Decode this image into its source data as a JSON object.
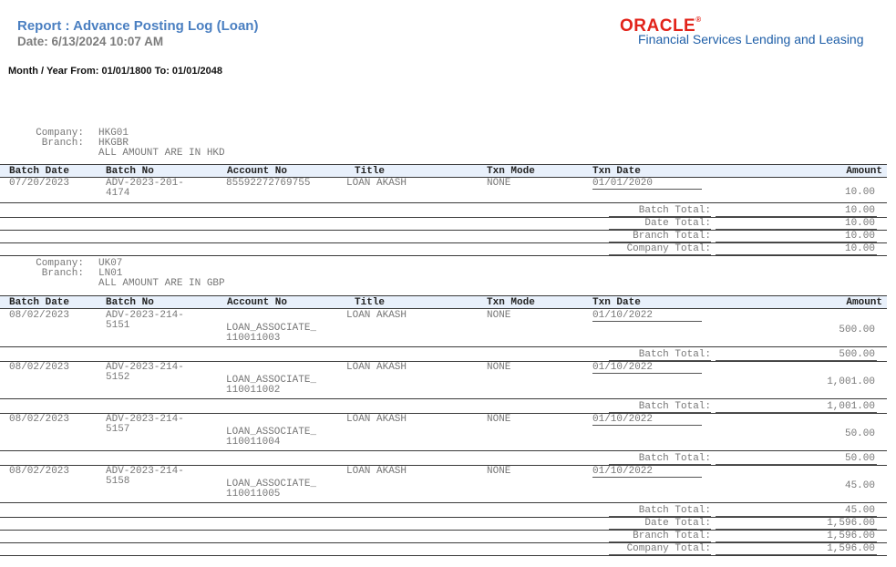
{
  "header": {
    "title": "Report : Advance Posting Log (Loan)",
    "date": "Date: 6/13/2024  10:07 AM",
    "logo_text": "ORACLE",
    "logo_tm": "®",
    "logo_subtitle": "Financial Services Lending and Leasing",
    "period": "Month / Year  From: 01/01/1800 To: 01/01/2048"
  },
  "labels": {
    "company": "Company:",
    "branch": "Branch:"
  },
  "columns": [
    "Batch Date",
    "Batch No",
    "Account No",
    "Title",
    "Txn Mode",
    "Txn Date",
    "Amount"
  ],
  "total_labels": {
    "batch": "Batch Total:",
    "date": "Date Total:",
    "branch": "Branch Total:",
    "company": "Company Total:"
  },
  "groups": [
    {
      "company": "HKG01",
      "branch": "HKGBR",
      "currency_note": "ALL AMOUNT ARE IN HKD",
      "rows": [
        {
          "batch_date": "07/20/2023",
          "batch_no": [
            "ADV-2023-201-",
            "4174"
          ],
          "account_no": [
            "85592272769755"
          ],
          "title": "LOAN AKASH",
          "txn_mode": "NONE",
          "txn_date": "01/01/2020",
          "amount": "10.00",
          "batch_total": "10.00"
        }
      ],
      "date_total": "10.00",
      "branch_total": "10.00",
      "company_total": "10.00"
    },
    {
      "company": "UK07",
      "branch": "LN01",
      "currency_note": "ALL AMOUNT ARE IN GBP",
      "rows": [
        {
          "batch_date": "08/02/2023",
          "batch_no": [
            "ADV-2023-214-",
            "5151"
          ],
          "account_no": [
            "LOAN_ASSOCIATE_",
            "110011003"
          ],
          "title": "LOAN AKASH",
          "txn_mode": "NONE",
          "txn_date": "01/10/2022",
          "amount": "500.00",
          "batch_total": "500.00"
        },
        {
          "batch_date": "08/02/2023",
          "batch_no": [
            "ADV-2023-214-",
            "5152"
          ],
          "account_no": [
            "LOAN_ASSOCIATE_",
            "110011002"
          ],
          "title": "LOAN AKASH",
          "txn_mode": "NONE",
          "txn_date": "01/10/2022",
          "amount": "1,001.00",
          "batch_total": "1,001.00"
        },
        {
          "batch_date": "08/02/2023",
          "batch_no": [
            "ADV-2023-214-",
            "5157"
          ],
          "account_no": [
            "LOAN_ASSOCIATE_",
            "110011004"
          ],
          "title": "LOAN AKASH",
          "txn_mode": "NONE",
          "txn_date": "01/10/2022",
          "amount": "50.00",
          "batch_total": "50.00"
        },
        {
          "batch_date": "08/02/2023",
          "batch_no": [
            "ADV-2023-214-",
            "5158"
          ],
          "account_no": [
            "LOAN_ASSOCIATE_",
            "110011005"
          ],
          "title": "LOAN AKASH",
          "txn_mode": "NONE",
          "txn_date": "01/10/2022",
          "amount": "45.00",
          "batch_total": "45.00"
        }
      ],
      "date_total": "1,596.00",
      "branch_total": "1,596.00",
      "company_total": "1,596.00"
    }
  ]
}
